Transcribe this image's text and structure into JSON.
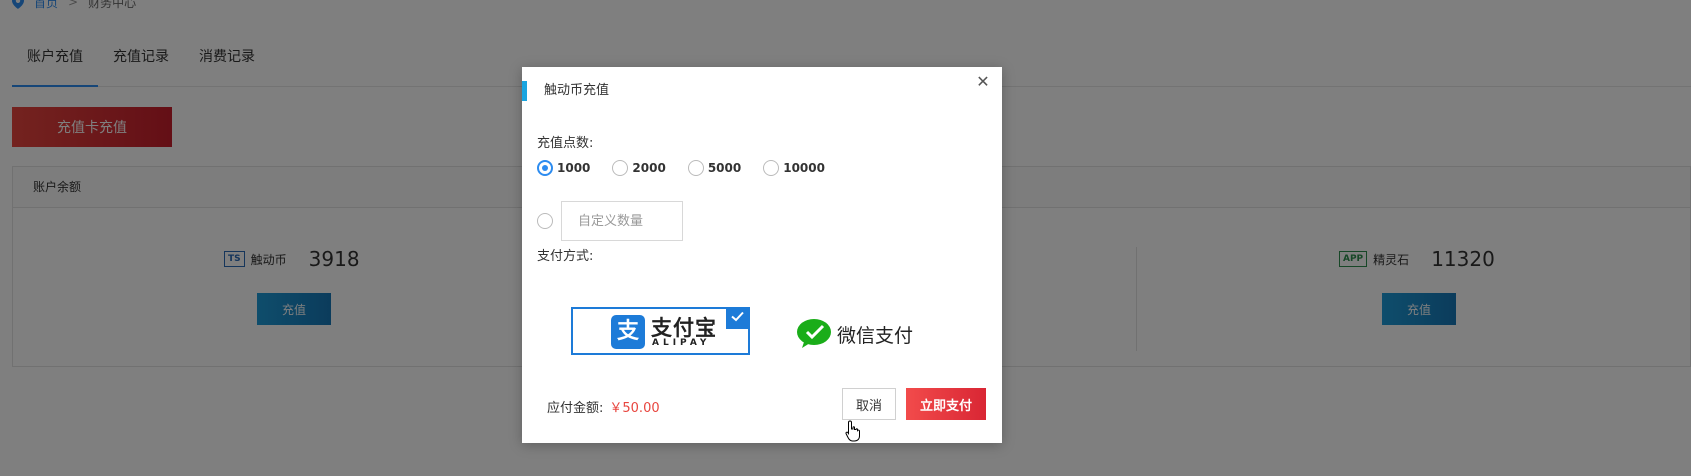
{
  "breadcrumb": {
    "home": "首页",
    "separator": ">",
    "current": "财务中心"
  },
  "tabs": [
    {
      "label": "账户充值",
      "active": true
    },
    {
      "label": "充值记录",
      "active": false
    },
    {
      "label": "消费记录",
      "active": false
    }
  ],
  "card_recharge_button": "充值卡充值",
  "balance_panel": {
    "title": "账户余额",
    "items": [
      {
        "icon": "ts-icon",
        "icon_text": "TS",
        "name": "触动币",
        "value": "3918",
        "button": "充值"
      },
      {
        "icon": "app-icon",
        "icon_text": "APP",
        "name": "精灵石",
        "value": "11320",
        "button": "充值"
      }
    ]
  },
  "modal": {
    "title": "触动币充值",
    "points_label": "充值点数:",
    "options": [
      {
        "label": "1000",
        "selected": true
      },
      {
        "label": "2000",
        "selected": false
      },
      {
        "label": "5000",
        "selected": false
      },
      {
        "label": "10000",
        "selected": false
      }
    ],
    "custom_placeholder": "自定义数量",
    "payment_label": "支付方式:",
    "alipay": {
      "text": "支付宝",
      "sub": "ALIPAY",
      "logo_char": "支",
      "selected": true
    },
    "wechat": {
      "text": "微信支付",
      "selected": false
    },
    "amount_label": "应付金额:",
    "amount_value": "￥50.00",
    "cancel_label": "取消",
    "pay_label": "立即支付"
  },
  "colors": {
    "accent_blue": "#2d8cf0",
    "alipay_blue": "#1d7bd8",
    "wechat_green": "#1aad19",
    "danger_red": "#e8463f"
  }
}
